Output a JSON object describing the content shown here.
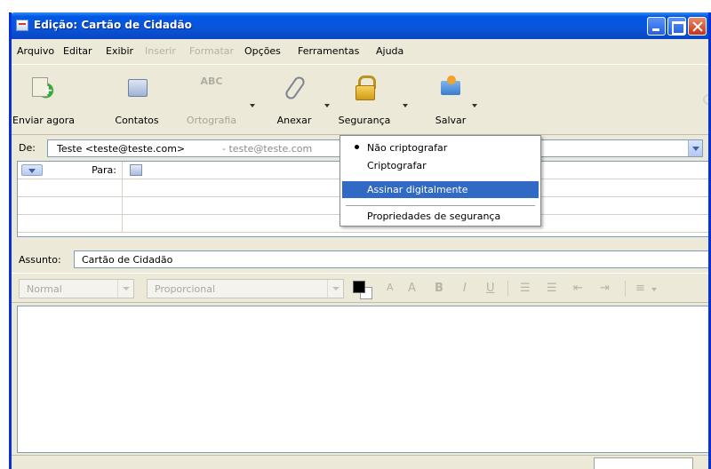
{
  "window": {
    "title": "Edição: Cartão de Cidadão"
  },
  "menubar": {
    "items": [
      {
        "label": "Arquivo",
        "enabled": true
      },
      {
        "label": "Editar",
        "enabled": true
      },
      {
        "label": "Exibir",
        "enabled": true
      },
      {
        "label": "Inserir",
        "enabled": false
      },
      {
        "label": "Formatar",
        "enabled": false
      },
      {
        "label": "Opções",
        "enabled": true
      },
      {
        "label": "Ferramentas",
        "enabled": true
      },
      {
        "label": "Ajuda",
        "enabled": true
      }
    ]
  },
  "toolbar": {
    "send": "Enviar agora",
    "contacts": "Contatos",
    "spelling_icon_text": "ABC",
    "spelling": "Ortografia",
    "attach": "Anexar",
    "security": "Segurança",
    "save": "Salvar"
  },
  "header": {
    "from_label": "De:",
    "from_value": "Teste <teste@teste.com>",
    "from_extra": "- teste@teste.com",
    "recipient_type": "Para:"
  },
  "subject": {
    "label": "Assunto:",
    "value": "Cartão de Cidadão"
  },
  "format_bar": {
    "paragraph_style": "Normal",
    "font": "Proporcional",
    "buttons": [
      "A",
      "A",
      "B",
      "I",
      "U"
    ]
  },
  "security_menu": {
    "items": [
      {
        "label": "Não criptografar",
        "checked": true,
        "selected": false
      },
      {
        "label": "Criptografar",
        "checked": false,
        "selected": false
      },
      {
        "label": "Assinar digitalmente",
        "checked": false,
        "selected": true
      },
      {
        "label": "Propriedades de segurança",
        "checked": false,
        "selected": false
      }
    ]
  },
  "colors": {
    "title_bar": "#0a55d8",
    "menu_highlight": "#316ac5",
    "window_bg": "#ece9d8"
  }
}
